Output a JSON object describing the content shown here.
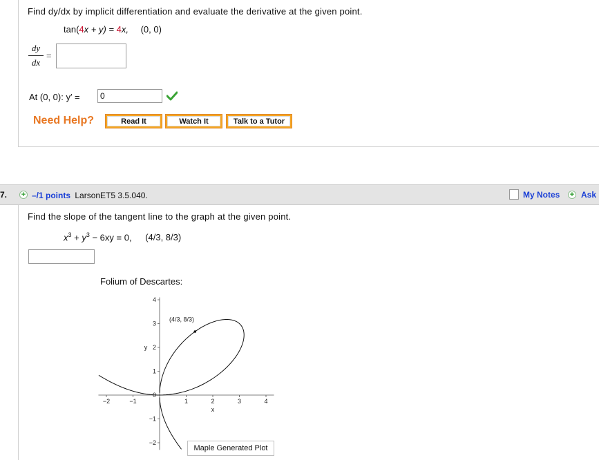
{
  "q1": {
    "prompt": "Find dy/dx by implicit differentiation and evaluate the derivative at the given point.",
    "eq_lhs": "tan(",
    "eq_red1": "4",
    "eq_mid": "x + y) = ",
    "eq_red2": "4",
    "eq_rhs": "x,",
    "point": "(0, 0)",
    "frac_num": "dy",
    "frac_den": "dx",
    "eq_sign": "=",
    "answer_value": "",
    "at_label": "At (0, 0): y′ =",
    "at_value": "0",
    "help_label": "Need Help?",
    "buttons": [
      "Read It",
      "Watch It",
      "Talk to a Tutor"
    ]
  },
  "q2": {
    "number": "7.",
    "points": "–/1 points",
    "source": "LarsonET5 3.5.040.",
    "my_notes": "My Notes",
    "ask": "Ask",
    "prompt": "Find the slope of the tangent line to the graph at the given point.",
    "eq_x": "x",
    "eq_y": "y",
    "eq_exp": "3",
    "eq_mid": " + ",
    "eq_tail": " − 6xy = 0,",
    "point": "(4/3, 8/3)",
    "answer_value": "",
    "plot_title": "Folium of Descartes:",
    "plot_point_label": "(4/3, 8/3)",
    "plot_footer": "Maple Generated Plot"
  },
  "chart_data": {
    "type": "line",
    "title": "Folium of Descartes:",
    "xlabel": "x",
    "ylabel": "y",
    "xlim": [
      -2.3,
      4.3
    ],
    "ylim": [
      -2.3,
      4.1
    ],
    "xticks": [
      -2,
      -1,
      0,
      1,
      2,
      3,
      4
    ],
    "yticks": [
      -2,
      -1,
      0,
      1,
      2,
      3,
      4
    ],
    "curve": "x^3 + y^3 - 6xy = 0",
    "point": {
      "x": 1.3333,
      "y": 2.6667,
      "label": "(4/3, 8/3)"
    },
    "footer": "Maple Generated Plot",
    "grid": false
  }
}
